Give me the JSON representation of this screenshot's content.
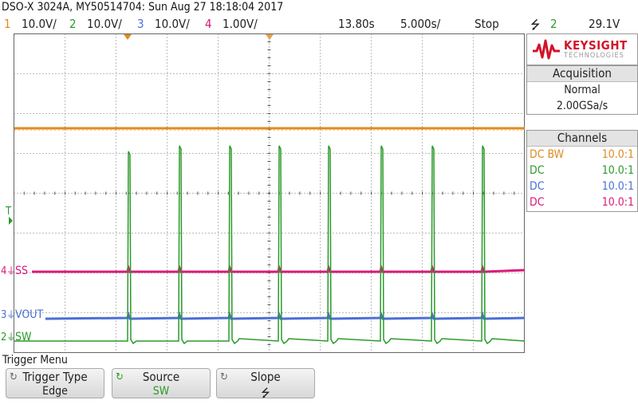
{
  "title": "DSO-X 3024A, MY50514704: Sun Aug 27 18:18:04 2017",
  "status": {
    "ch1": {
      "num": "1",
      "scale": "10.0V/",
      "color": "#e08a1e"
    },
    "ch2": {
      "num": "2",
      "scale": "10.0V/",
      "color": "#2a9a2a"
    },
    "ch3": {
      "num": "3",
      "scale": "10.0V/",
      "color": "#4a6fd6"
    },
    "ch4": {
      "num": "4",
      "scale": "1.00V/",
      "color": "#d81b7a"
    },
    "delay": "13.80s",
    "timebase": "5.000s/",
    "run_state": "Stop",
    "trigger_slope_icon": "falling-edge-icon",
    "trigger_channel": "2",
    "trigger_level": "29.1V"
  },
  "brand": {
    "name": "KEYSIGHT",
    "sub": "TECHNOLOGIES",
    "color": "#d2142a"
  },
  "acquisition": {
    "header": "Acquisition",
    "mode": "Normal",
    "rate": "2.00GSa/s"
  },
  "channels": {
    "header": "Channels",
    "rows": [
      {
        "coupling": "DC BW",
        "probe": "10.0:1",
        "color": "#e08a1e"
      },
      {
        "coupling": "DC",
        "probe": "10.0:1",
        "color": "#2a9a2a"
      },
      {
        "coupling": "DC",
        "probe": "10.0:1",
        "color": "#4a6fd6"
      },
      {
        "coupling": "DC",
        "probe": "10.0:1",
        "color": "#d81b7a"
      }
    ]
  },
  "markers": {
    "trigger": "T",
    "ss_num": "4",
    "ss_label": "SS",
    "vout_num": "3",
    "vout_label": "VOUT",
    "sw_num": "2",
    "sw_label": "SW"
  },
  "menu": {
    "title": "Trigger Menu",
    "keys": [
      {
        "label": "Trigger Type",
        "value": "Edge"
      },
      {
        "label": "Source",
        "value": "SW"
      },
      {
        "label": "Slope",
        "value": "⭍"
      }
    ]
  }
}
